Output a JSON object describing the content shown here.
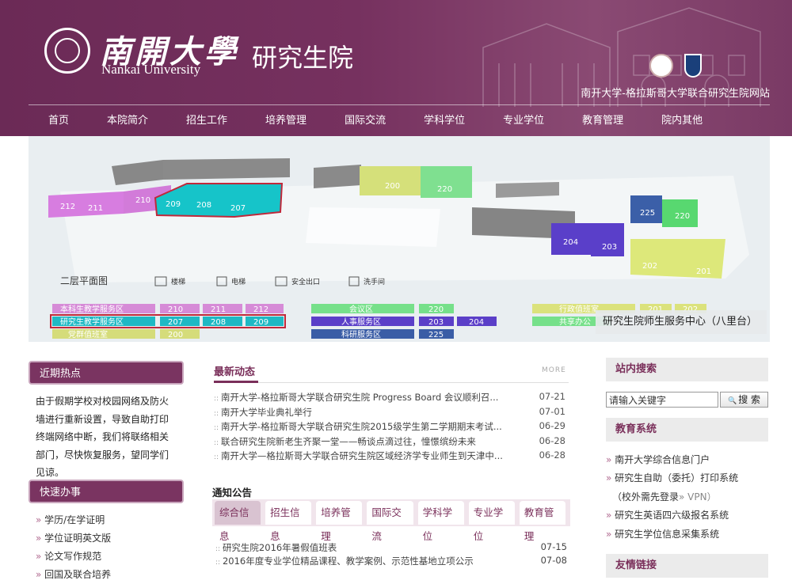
{
  "header": {
    "university_cn": "南開大學",
    "university_en": "Nankai University",
    "department": "研究生院",
    "site_subtitle": "南开大学-格拉斯哥大学联合研究生院网站"
  },
  "nav": [
    "首页",
    "本院简介",
    "招生工作",
    "培养管理",
    "国际交流",
    "学科学位",
    "专业学位",
    "教育管理",
    "院内其他"
  ],
  "banner": {
    "caption": "研究生院师生服务中心（八里台）",
    "floor_label": "二层平面图",
    "legend": [
      "楼梯",
      "电梯",
      "安全出口",
      "洗手间"
    ],
    "rooms": [
      "212",
      "211",
      "210",
      "209",
      "208",
      "207",
      "200",
      "220",
      "225",
      "220",
      "204",
      "203",
      "202",
      "201"
    ],
    "table": {
      "col1": [
        {
          "name": "本科生教学服务区",
          "rooms": [
            "210",
            "211",
            "212"
          ]
        },
        {
          "name": "研究生教学服务区",
          "rooms": [
            "207",
            "208",
            "209"
          ]
        },
        {
          "name": "党群值班室",
          "rooms": [
            "200"
          ]
        }
      ],
      "col2": [
        {
          "name": "会议区",
          "rooms": [
            "220"
          ]
        },
        {
          "name": "人事服务区",
          "rooms": [
            "203",
            "204"
          ]
        },
        {
          "name": "科研服务区",
          "rooms": [
            "225"
          ]
        }
      ],
      "col3": [
        {
          "name": "行政值班室",
          "rooms": [
            "201",
            "202"
          ]
        },
        {
          "name": "共享办公",
          "rooms": []
        }
      ]
    }
  },
  "left": {
    "hot_title": "近期热点",
    "hot_text": "由于假期学校对校园网络及防火墙进行重新设置，导致自助打印终端网络中断，我们将联络相关部门，尽快恢复服务，望同学们见谅。",
    "quick_title": "快速办事",
    "quick_links": [
      "学历/在学证明",
      "学位证明英文版",
      "论文写作规范",
      "回国及联合培养"
    ]
  },
  "news": {
    "title": "最新动态",
    "more": "MORE",
    "items": [
      {
        "title": "南开大学-格拉斯哥大学联合研究生院 Progress Board 会议顺利召...",
        "date": "07-21"
      },
      {
        "title": "南开大学毕业典礼举行",
        "date": "07-01"
      },
      {
        "title": "南开大学-格拉斯哥大学联合研究生院2015级学生第二学期期末考试...",
        "date": "06-29"
      },
      {
        "title": "联合研究生院新老生齐聚一堂——畅谈点滴过往，憧憬缤纷未来",
        "date": "06-28"
      },
      {
        "title": "南开大学—格拉斯哥大学联合研究生院区域经济学专业师生到天津中...",
        "date": "06-28"
      }
    ]
  },
  "notices": {
    "title": "通知公告",
    "tabs": [
      "综合信息",
      "招生信息",
      "培养管理",
      "国际交流",
      "学科学位",
      "专业学位",
      "教育管理"
    ],
    "items": [
      {
        "title": "研究生院2016年暑假值班表",
        "date": "07-15"
      },
      {
        "title": "2016年度专业学位精品课程、教学案例、示范性基地立项公示",
        "date": "07-08"
      }
    ]
  },
  "right": {
    "search_title": "站内搜索",
    "search_value": "请输入关键字",
    "search_button": "搜 索",
    "edu_title": "教育系统",
    "edu_links": [
      "南开大学综合信息门户",
      "研究生自助（委托）打印系统"
    ],
    "edu_sub": "（校外需先登录",
    "edu_sub_vpn": "» VPN）",
    "edu_links2": [
      "研究生英语四六级报名系统",
      "研究生学位信息采集系统"
    ],
    "friend_title": "友情链接"
  }
}
